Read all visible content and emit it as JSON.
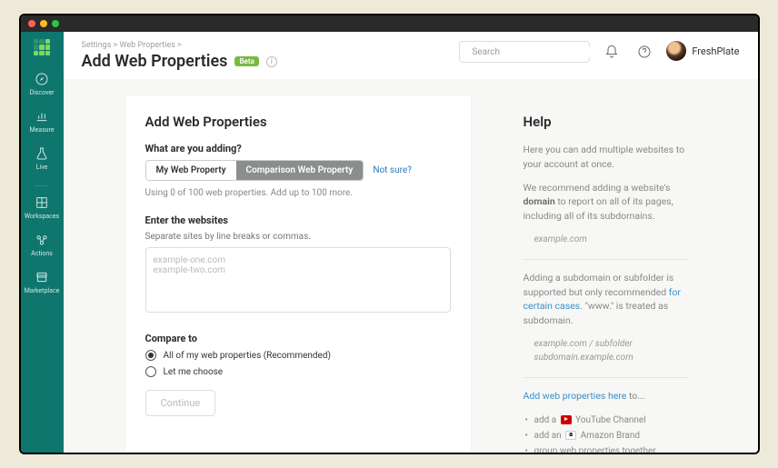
{
  "breadcrumbs": "Settings > Web Properties >",
  "page_title": "Add Web Properties",
  "badge": "Beta",
  "search_placeholder": "Search",
  "user_name": "FreshPlate",
  "sidebar": {
    "items": [
      {
        "label": "Discover"
      },
      {
        "label": "Measure"
      },
      {
        "label": "Live"
      },
      {
        "label": "Workspaces"
      },
      {
        "label": "Actions"
      },
      {
        "label": "Marketplace"
      }
    ]
  },
  "form": {
    "heading": "Add Web Properties",
    "q1": "What are you adding?",
    "seg_a": "My Web Property",
    "seg_b": "Comparison Web Property",
    "not_sure": "Not sure?",
    "usage_hint": "Using 0 of 100 web properties. Add up to 100 more.",
    "q2": "Enter the websites",
    "q2_sub": "Separate sites by line breaks or commas.",
    "placeholder": "example-one.com\nexample-two.com",
    "q3": "Compare to",
    "radio1": "All of my web properties (Recommended)",
    "radio2": "Let me choose",
    "continue": "Continue"
  },
  "help": {
    "title": "Help",
    "p1a": "Here you can add multiple websites to your account at once.",
    "p2a": "We recommend adding a website's ",
    "p2b": "domain",
    "p2c": " to report on all of its pages, including all of its subdomains.",
    "ex1": "example.com",
    "p3a": "Adding a subdomain or subfolder is supported but only recommended ",
    "p3b": "for certain cases",
    "p3c": ". \"www.\" is treated as subdomain.",
    "ex2a": "example.com / subfolder",
    "ex2b": "subdomain.example.com",
    "cta": "Add web properties here",
    "cta_suffix": " to...",
    "li1a": "add a ",
    "li1b": " YouTube Channel",
    "li2a": "add an ",
    "li2b": " Amazon Brand",
    "li3": "group web properties together"
  }
}
